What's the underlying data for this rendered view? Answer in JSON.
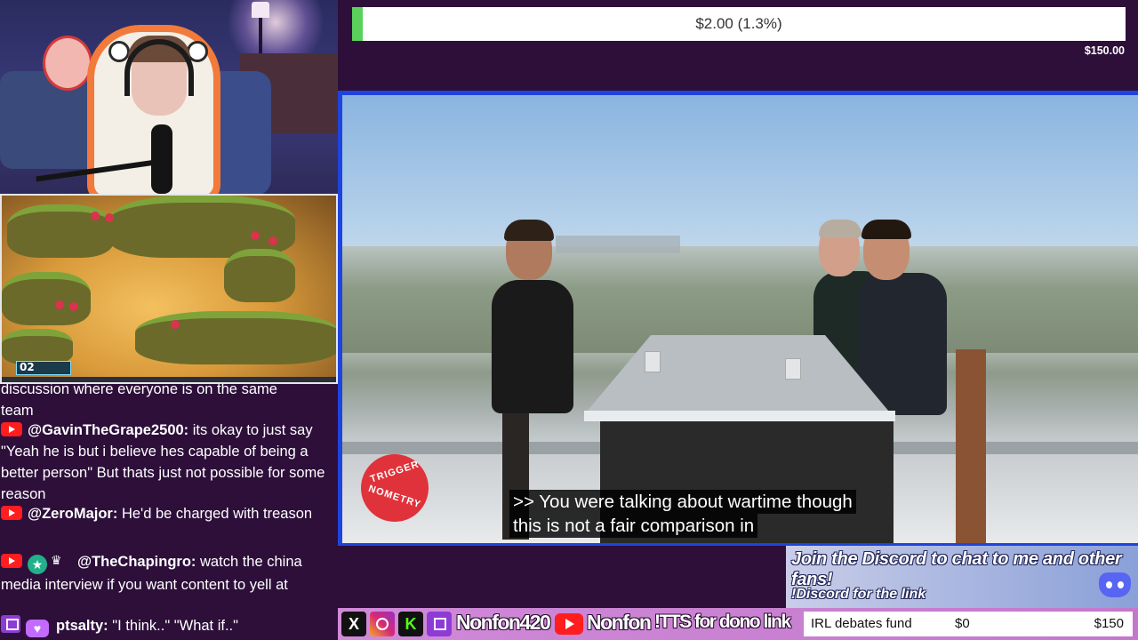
{
  "donation_goal": {
    "current": "$2.00 (1.3%)",
    "progress_fraction": 0.013,
    "target": "$150.00",
    "fill_color": "#5ad15a"
  },
  "chat": {
    "partial_message": {
      "text_line1": "discussion where everyone is on the same",
      "text_line2": "team"
    },
    "messages": [
      {
        "platform": "youtube",
        "user": "@GavinTheGrape2500:",
        "text": "its okay to just say \"Yeah he is but i believe hes capable of being a better person\" But thats just not possible for some reason"
      },
      {
        "platform": "youtube",
        "user": "@ZeroMajor:",
        "text": "He'd be charged with treason"
      },
      {
        "platform": "youtube",
        "badges": [
          "member-badge-icon",
          "crown-badge-icon"
        ],
        "user": "@TheChapingro:",
        "text": "watch the china media interview if you want content to yell at"
      },
      {
        "platform": "twitch",
        "badges": [
          "heart-badge-icon"
        ],
        "user": "ptsalty:",
        "text": "\"I think..\" \"What if..\""
      }
    ]
  },
  "game": {
    "hud_number": "02"
  },
  "video": {
    "logo_top": "TRIGGER",
    "logo_bottom": "NOMETRY",
    "subtitle_line1": ">> You were talking about wartime though",
    "subtitle_line2": "this is not a fair comparison in"
  },
  "discord": {
    "title": "Join the Discord to chat to me and other fans!",
    "subtitle": "!Discord for the link",
    "icon": "discord-icon"
  },
  "socials": {
    "handle_primary": "Nonfon420",
    "handle_youtube": "Nonfon",
    "tts_text": "!TTS for dono link",
    "icons": [
      "x-icon",
      "instagram-icon",
      "kick-icon",
      "twitch-icon",
      "youtube-icon"
    ]
  },
  "fund": {
    "name": "IRL debates fund",
    "current": "$0",
    "goal": "$150"
  },
  "colors": {
    "background": "#2d0f3a",
    "video_border": "#1e44e0",
    "socials_bar": "#c378cc",
    "youtube_red": "#ff1d1d",
    "twitch_purple": "#8e3bd6"
  }
}
